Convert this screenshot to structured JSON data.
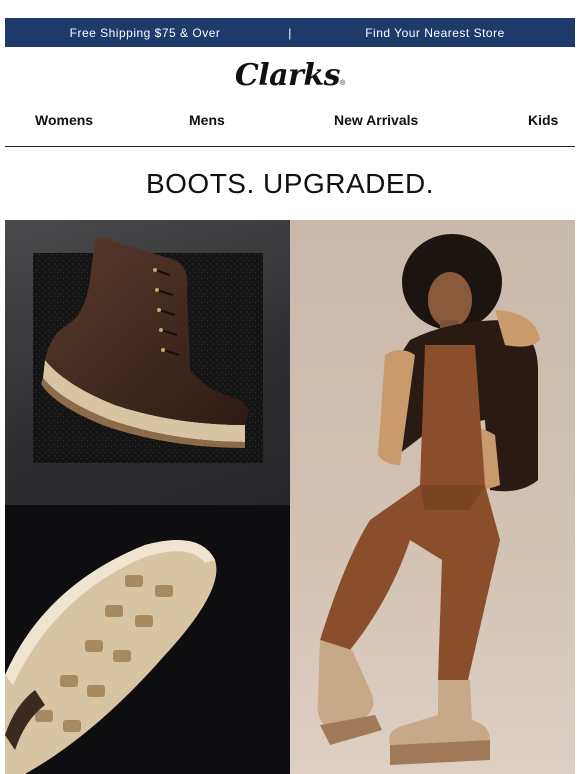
{
  "topbar": {
    "shipping": "Free Shipping $75 & Over",
    "separator": "|",
    "store": "Find Your Nearest Store"
  },
  "logo": {
    "text": "Clarks",
    "reg": "®"
  },
  "nav": {
    "items": [
      "Womens",
      "Mens",
      "New Arrivals",
      "Kids"
    ]
  },
  "headline": "BOOTS. UPGRADED.",
  "images": {
    "boot": "boot-on-textured-mat",
    "sole": "boot-sole-closeup",
    "model": "model-in-shearling-jacket-and-boots"
  },
  "colors": {
    "topbar": "#1d3a6b",
    "boot_leather": "#4a2e22",
    "sole": "#d8c4a3",
    "jumpsuit": "#8a4e2c",
    "shearling": "#c89a6c"
  }
}
